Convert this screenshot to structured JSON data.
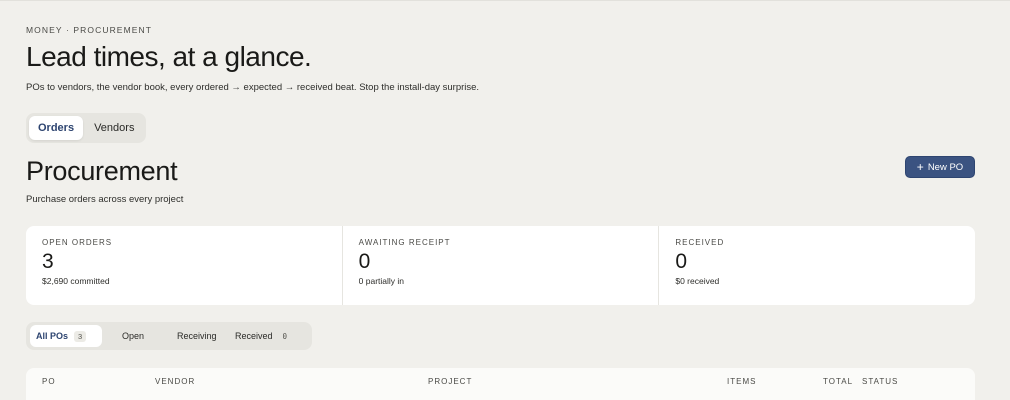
{
  "header": {
    "eyebrow": "MONEY · PROCUREMENT",
    "title": "Lead times, at a glance.",
    "subtitle": "POs to vendors, the vendor book, every ordered → expected → received beat. Stop the install-day surprise."
  },
  "tabs": [
    {
      "label": "Orders",
      "active": true
    },
    {
      "label": "Vendors",
      "active": false
    }
  ],
  "section": {
    "title": "Procurement",
    "subtitle": "Purchase orders across every project",
    "new_po_label": "New PO",
    "new_po_icon": "plus-icon"
  },
  "stats": [
    {
      "label": "OPEN ORDERS",
      "value": "3",
      "caption": "$2,690 committed"
    },
    {
      "label": "AWAITING RECEIPT",
      "value": "0",
      "caption": "0 partially in"
    },
    {
      "label": "RECEIVED",
      "value": "0",
      "caption": "$0 received"
    }
  ],
  "filters": [
    {
      "label": "All POs",
      "count": "3",
      "active": true
    },
    {
      "label": "Open",
      "count": "",
      "active": false
    },
    {
      "label": "Receiving",
      "count": "",
      "active": false
    },
    {
      "label": "Received",
      "count": "0",
      "active": false
    }
  ],
  "table": {
    "columns": [
      "PO",
      "VENDOR",
      "PROJECT",
      "ITEMS",
      "TOTAL",
      "STATUS"
    ]
  },
  "colors": {
    "background": "#f1f0ec",
    "accent": "#3b5381",
    "card": "#ffffff"
  }
}
